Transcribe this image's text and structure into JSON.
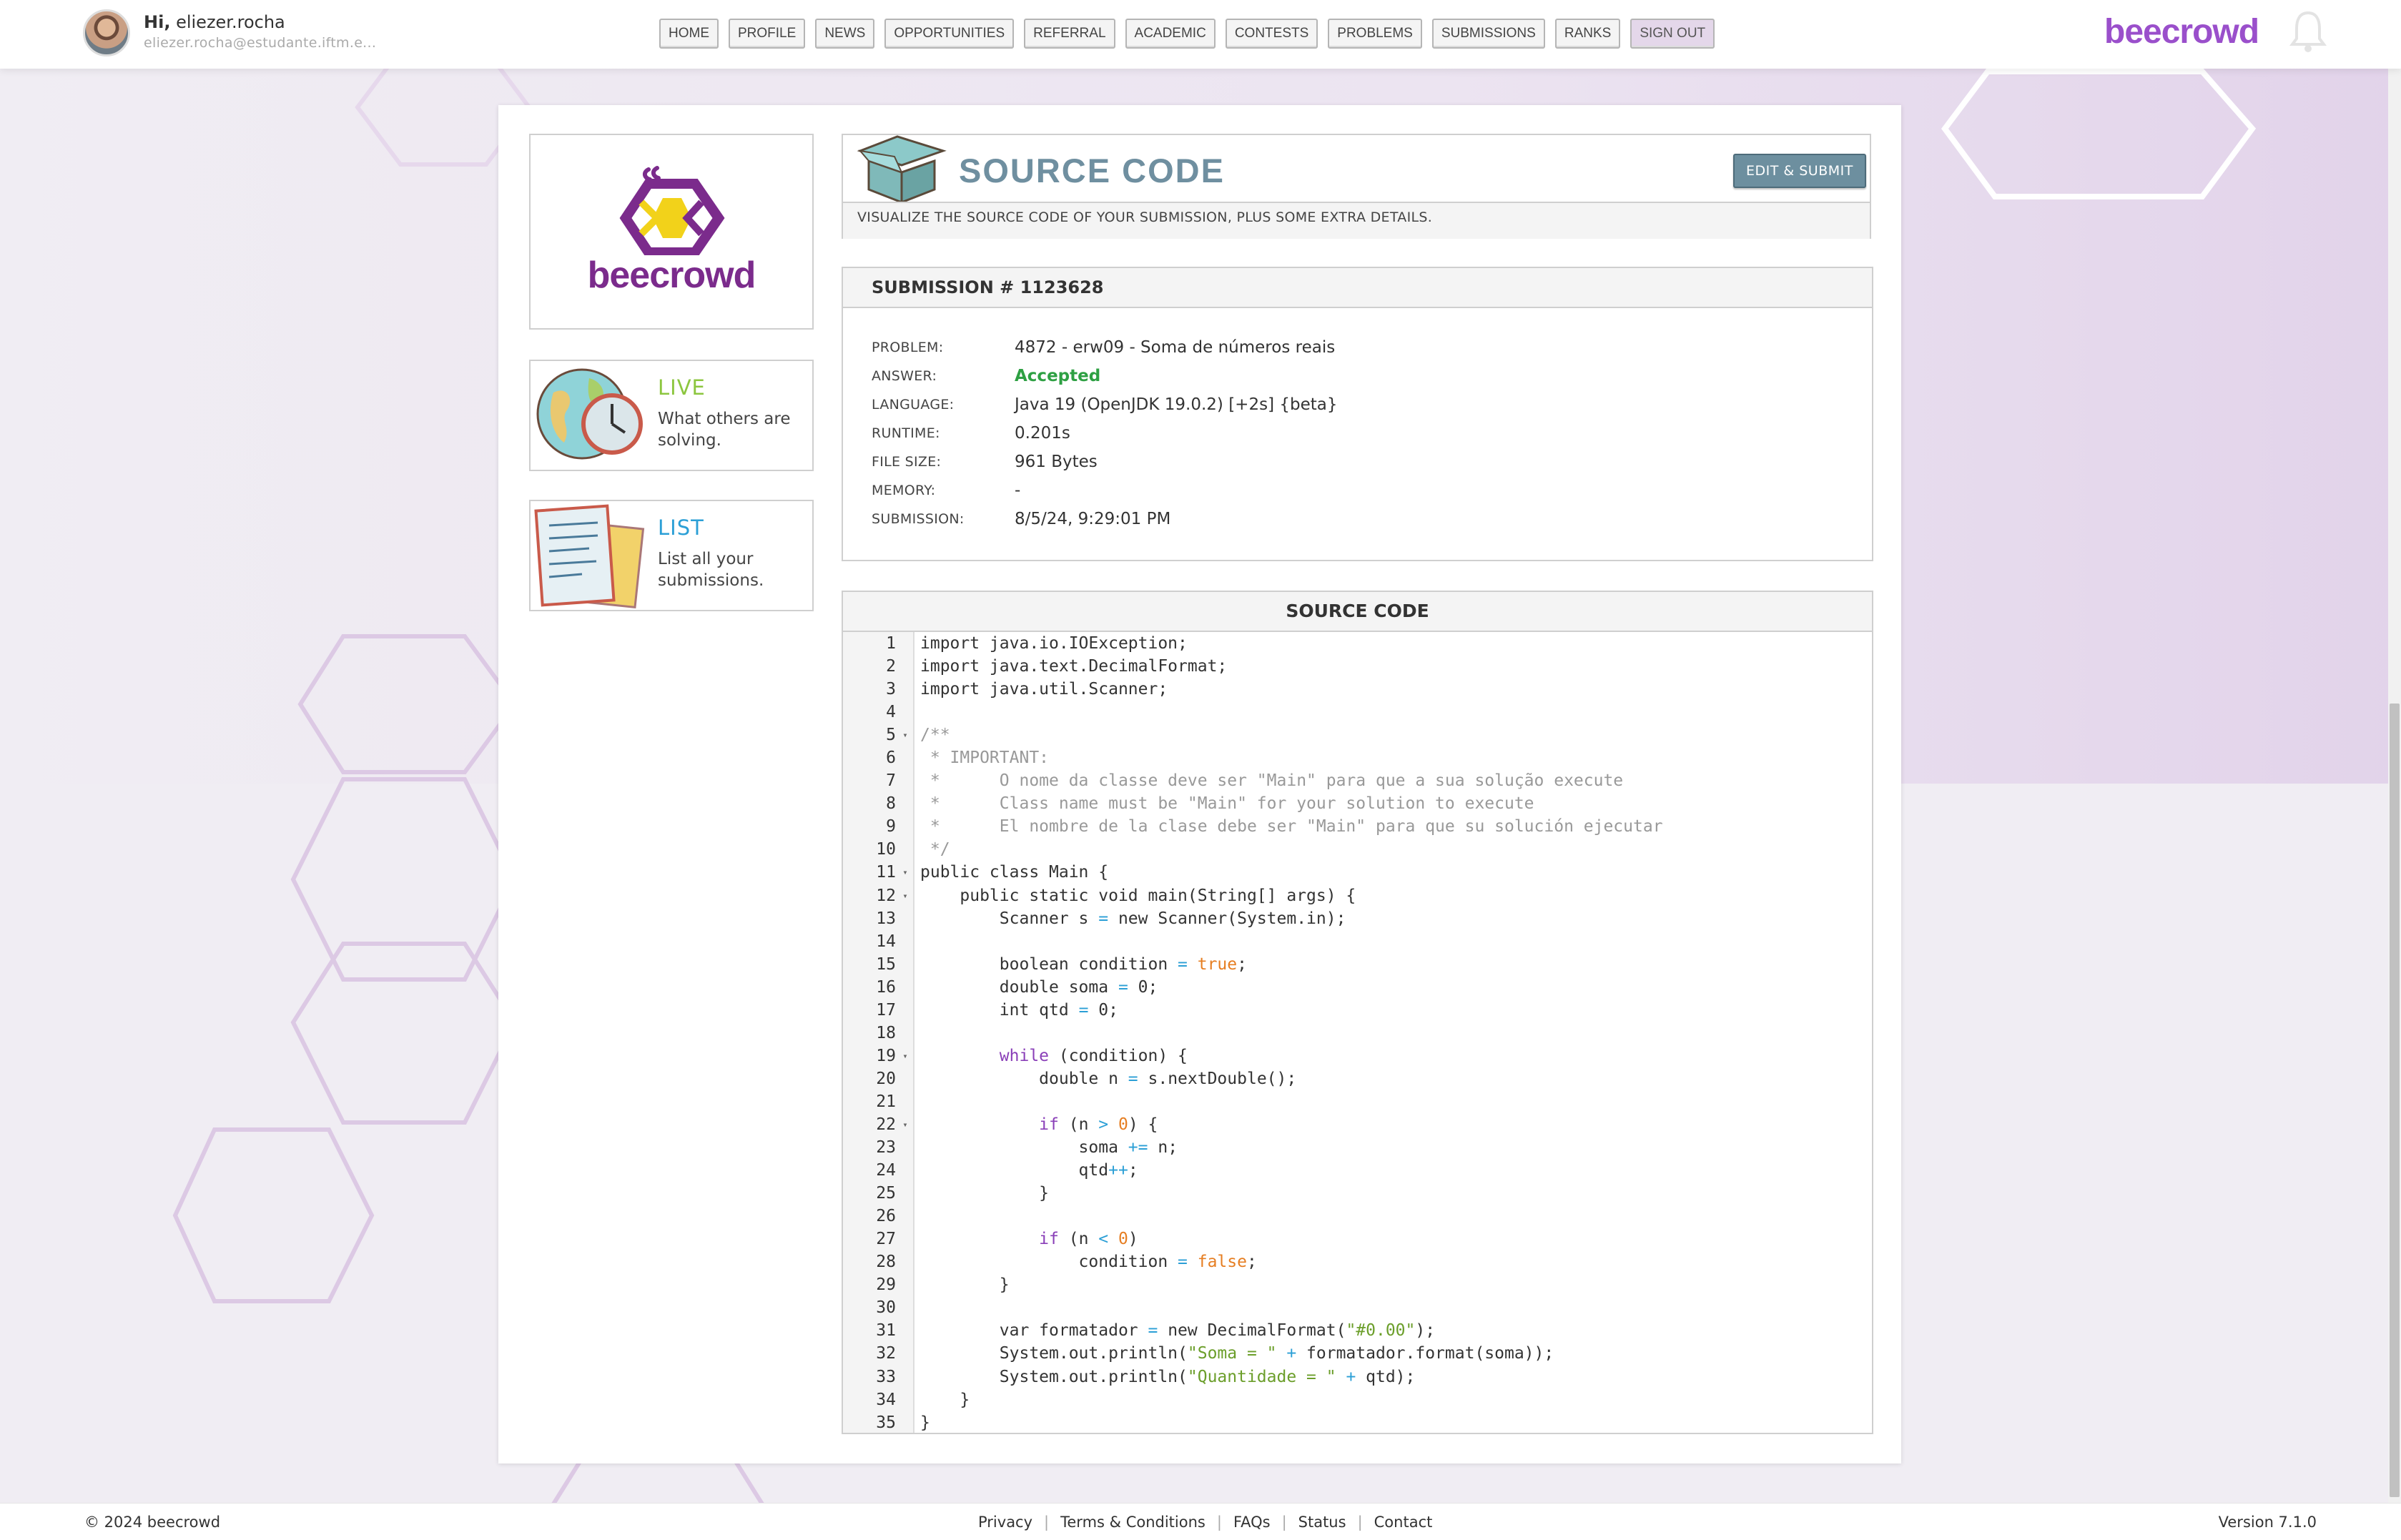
{
  "header": {
    "greeting_prefix": "Hi,",
    "username": "eliezer.rocha",
    "email": "eliezer.rocha@estudante.iftm.e...",
    "nav": [
      "HOME",
      "PROFILE",
      "NEWS",
      "OPPORTUNITIES",
      "REFERRAL",
      "ACADEMIC",
      "CONTESTS",
      "PROBLEMS",
      "SUBMISSIONS",
      "RANKS",
      "SIGN OUT"
    ],
    "brand": "beecrowd"
  },
  "sidebar": {
    "logo_text": "beecrowd",
    "live": {
      "title": "LIVE",
      "desc": "What others are solving."
    },
    "list": {
      "title": "LIST",
      "desc": "List all your submissions."
    }
  },
  "source_header": {
    "title": "SOURCE CODE",
    "subtitle": "VISUALIZE THE SOURCE CODE OF YOUR SUBMISSION, PLUS SOME EXTRA DETAILS.",
    "edit_button": "EDIT & SUBMIT"
  },
  "submission": {
    "heading": "SUBMISSION # 1123628",
    "rows": [
      {
        "key": "PROBLEM:",
        "value": "4872 - erw09 - Soma de números reais"
      },
      {
        "key": "ANSWER:",
        "value": "Accepted"
      },
      {
        "key": "LANGUAGE:",
        "value": "Java 19 (OpenJDK 19.0.2) [+2s] {beta}"
      },
      {
        "key": "RUNTIME:",
        "value": "0.201s"
      },
      {
        "key": "FILE SIZE:",
        "value": "961 Bytes"
      },
      {
        "key": "MEMORY:",
        "value": "-"
      },
      {
        "key": "SUBMISSION:",
        "value": "8/5/24, 9:29:01 PM"
      }
    ]
  },
  "code": {
    "heading": "SOURCE CODE",
    "lines": [
      "import java.io.IOException;",
      "import java.text.DecimalFormat;",
      "import java.util.Scanner;",
      "",
      "/**",
      " * IMPORTANT:",
      " *      O nome da classe deve ser \"Main\" para que a sua solução execute",
      " *      Class name must be \"Main\" for your solution to execute",
      " *      El nombre de la clase debe ser \"Main\" para que su solución ejecutar",
      " */",
      "public class Main {",
      "    public static void main(String[] args) {",
      "        Scanner s = new Scanner(System.in);",
      "",
      "        boolean condition = true;",
      "        double soma = 0;",
      "        int qtd = 0;",
      "",
      "        while (condition) {",
      "            double n = s.nextDouble();",
      "",
      "            if (n > 0) {",
      "                soma += n;",
      "                qtd++;",
      "            }",
      "",
      "            if (n < 0)",
      "                condition = false;",
      "        }",
      "",
      "        var formatador = new DecimalFormat(\"#0.00\");",
      "        System.out.println(\"Soma = \" + formatador.format(soma));",
      "        System.out.println(\"Quantidade = \" + qtd);",
      "    }",
      "}"
    ],
    "fold_lines": [
      5,
      11,
      12,
      19,
      22
    ]
  },
  "footer": {
    "copyright": "© 2024 beecrowd",
    "links": [
      "Privacy",
      "Terms & Conditions",
      "FAQs",
      "Status",
      "Contact"
    ],
    "version": "Version 7.1.0"
  },
  "colors": {
    "brand": "#9a4fcb",
    "accepted": "#2ea043",
    "live": "#8cc63f",
    "list": "#2b9fd6"
  }
}
